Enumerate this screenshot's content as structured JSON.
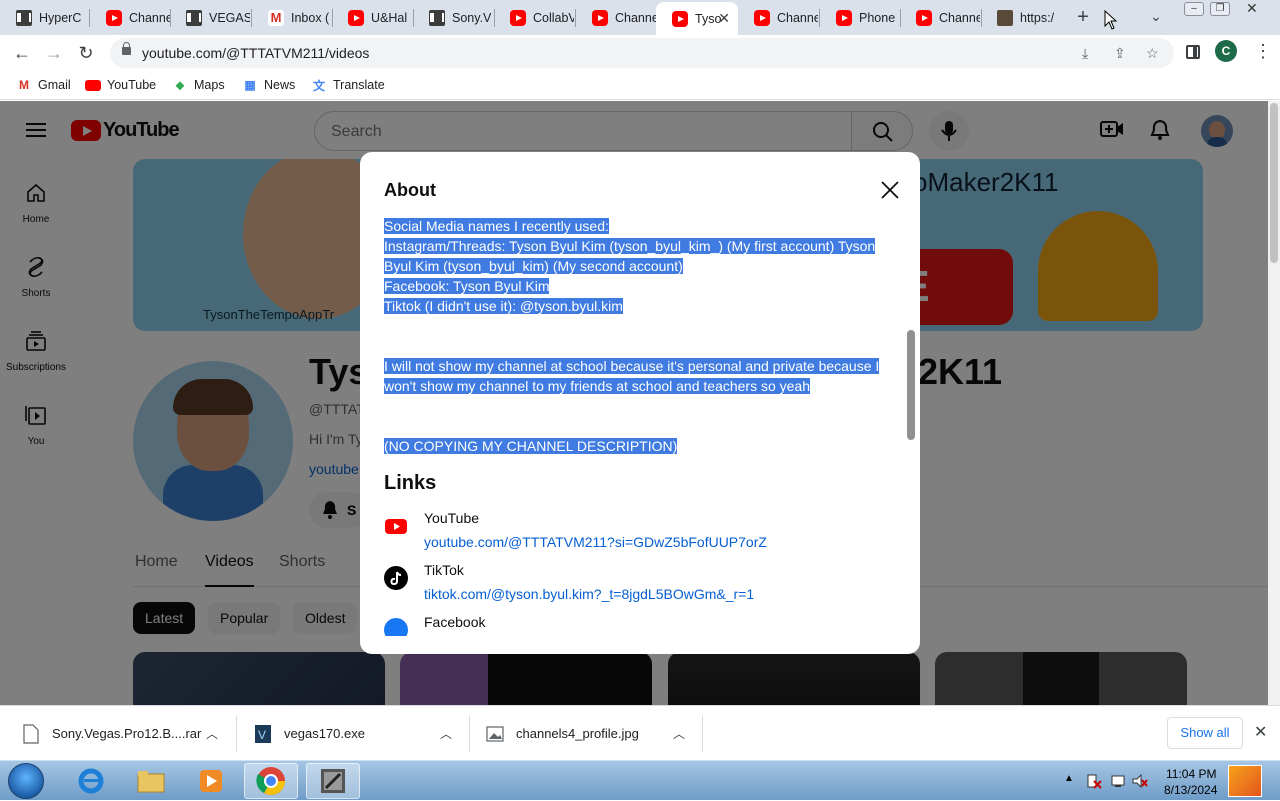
{
  "browser": {
    "tabs": [
      {
        "label": "HyperC",
        "icon": "bars-icon"
      },
      {
        "label": "Channe",
        "icon": "youtube-icon"
      },
      {
        "label": "VEGAS",
        "icon": "bars-icon"
      },
      {
        "label": "Inbox (",
        "icon": "gmail-icon"
      },
      {
        "label": "U&Hal",
        "icon": "youtube-icon"
      },
      {
        "label": "Sony.V",
        "icon": "bars-icon"
      },
      {
        "label": "CollabV",
        "icon": "youtube-icon"
      },
      {
        "label": "Channe",
        "icon": "youtube-icon"
      },
      {
        "label": "Tyso",
        "icon": "youtube-icon",
        "active": true
      },
      {
        "label": "Channe",
        "icon": "youtube-icon"
      },
      {
        "label": "Phone",
        "icon": "youtube-icon"
      },
      {
        "label": "Channe",
        "icon": "youtube-icon"
      },
      {
        "label": "https:/",
        "icon": "image-icon"
      }
    ],
    "url": "youtube.com/@TTTATVM211/videos",
    "profile_initial": "C",
    "bookmarks": [
      {
        "label": "Gmail",
        "icon": "gmail-icon"
      },
      {
        "label": "YouTube",
        "icon": "youtube-icon"
      },
      {
        "label": "Maps",
        "icon": "maps-icon"
      },
      {
        "label": "News",
        "icon": "news-icon"
      },
      {
        "label": "Translate",
        "icon": "translate-icon"
      }
    ]
  },
  "youtube": {
    "logo_text": "YouTube",
    "search_placeholder": "Search",
    "guide": [
      {
        "label": "Home"
      },
      {
        "label": "Shorts"
      },
      {
        "label": "Subscriptions"
      },
      {
        "label": "You"
      }
    ],
    "banner": {
      "left_text": "TysonTheTempoAppTr",
      "right_text": "oMaker2K11",
      "sub_text": "IBE"
    },
    "channel": {
      "title_left": "Tys",
      "title_right": "2K11",
      "handle": "@TTTAT",
      "description": "Hi I'm Ty",
      "link": "youtube",
      "subscribe_label": "S"
    },
    "tabs": [
      "Home",
      "Videos",
      "Shorts"
    ],
    "active_tab": "Videos",
    "chips": [
      "Latest",
      "Popular",
      "Oldest"
    ],
    "active_chip": "Latest"
  },
  "about": {
    "title": "About",
    "description_lines": [
      "Social Media names I recently used:",
      "Instagram/Threads: Tyson Byul Kim (tyson_byul_kim_) (My first account) Tyson",
      "Byul Kim (tyson_byul_kim) (My second account)",
      "Facebook: Tyson Byul Kim",
      "Tiktok (I didn't use it): @tyson.byul.kim",
      "",
      "",
      "I will not show my channel at school because it's personal and private because I",
      "won't show my channel to my friends at school and teachers so yeah",
      "",
      "",
      "(NO COPYING MY CHANNEL DESCRIPTION)"
    ],
    "links_title": "Links",
    "links": [
      {
        "name": "YouTube",
        "url": "youtube.com/@TTTATVM211?si=GDwZ5bFofUUP7orZ",
        "icon": "youtube-icon"
      },
      {
        "name": "TikTok",
        "url": "tiktok.com/@tyson.byul.kim?_t=8jgdL5BOwGm&_r=1",
        "icon": "tiktok-icon"
      },
      {
        "name": "Facebook",
        "url": "",
        "icon": "facebook-icon"
      }
    ]
  },
  "downloads": {
    "items": [
      {
        "name": "Sony.Vegas.Pro12.B....rar",
        "icon": "file-icon"
      },
      {
        "name": "vegas170.exe",
        "icon": "vegas-icon"
      },
      {
        "name": "channels4_profile.jpg",
        "icon": "image-file-icon"
      }
    ],
    "show_all": "Show all"
  },
  "taskbar": {
    "time": "11:04 PM",
    "date": "8/13/2024"
  },
  "colors": {
    "selection": "#3f7be0",
    "youtube_red": "#ff0000",
    "link_blue": "#065fd4"
  }
}
